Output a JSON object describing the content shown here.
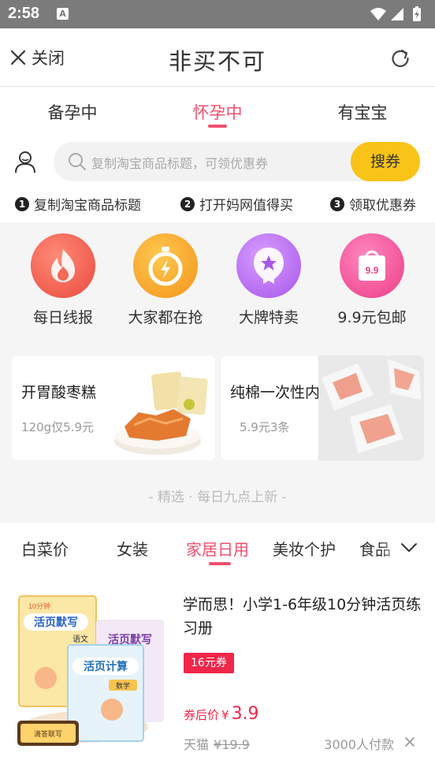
{
  "status_bar": {
    "time": "2:58",
    "notif_letter": "A"
  },
  "header": {
    "close_label": "关闭",
    "title": "非买不可"
  },
  "stages": [
    {
      "label": "备孕中",
      "active": false
    },
    {
      "label": "怀孕中",
      "active": true
    },
    {
      "label": "有宝宝",
      "active": false
    }
  ],
  "search": {
    "placeholder": "复制淘宝商品标题，可领优惠券",
    "button_label": "搜券"
  },
  "steps": [
    {
      "num": "1",
      "label": "复制淘宝商品标题"
    },
    {
      "num": "2",
      "label": "打开妈网值得买"
    },
    {
      "num": "3",
      "label": "领取优惠券"
    }
  ],
  "categories": [
    {
      "label": "每日线报",
      "icon": "flame-icon",
      "color": "#f05a4a"
    },
    {
      "label": "大家都在抢",
      "icon": "stopwatch-icon",
      "color": "#f7a01c"
    },
    {
      "label": "大牌特卖",
      "icon": "badge-star-icon",
      "color": "#b46ef0"
    },
    {
      "label": "9.9元包邮",
      "icon": "shopping-bag-icon",
      "color": "#f0468c",
      "icon_text": "9.9"
    }
  ],
  "promos": [
    {
      "title": "开胃酸枣糕",
      "subtitle": "120g仅5.9元"
    },
    {
      "title": "纯棉一次性内裤",
      "subtitle": "5.9元3条"
    }
  ],
  "tagline": "- 精选 · 每日九点上新 -",
  "tabs": [
    {
      "label": "白菜价",
      "active": false
    },
    {
      "label": "女装",
      "active": false
    },
    {
      "label": "家居日用",
      "active": true
    },
    {
      "label": "美妆个护",
      "active": false
    },
    {
      "label": "食品",
      "active": false
    }
  ],
  "product": {
    "title": "学而思！小学1-6年级10分钟活页练习册",
    "coupon": "16元券",
    "after_label": "券后价",
    "currency": "¥",
    "price": "3.9",
    "source": "天猫",
    "original_price": "¥19.9",
    "paid_count": "3000人付款",
    "image_texts": {
      "book1": "活页默写",
      "book1_sub": "语文",
      "book2": "活页默写",
      "book3": "活页计算",
      "book3_sub": "数学",
      "badge": "10分钟",
      "label": "滴答联写"
    }
  },
  "colors": {
    "accent": "#f0506e",
    "coupon_red": "#f0264a",
    "search_button": "#f9c417"
  }
}
